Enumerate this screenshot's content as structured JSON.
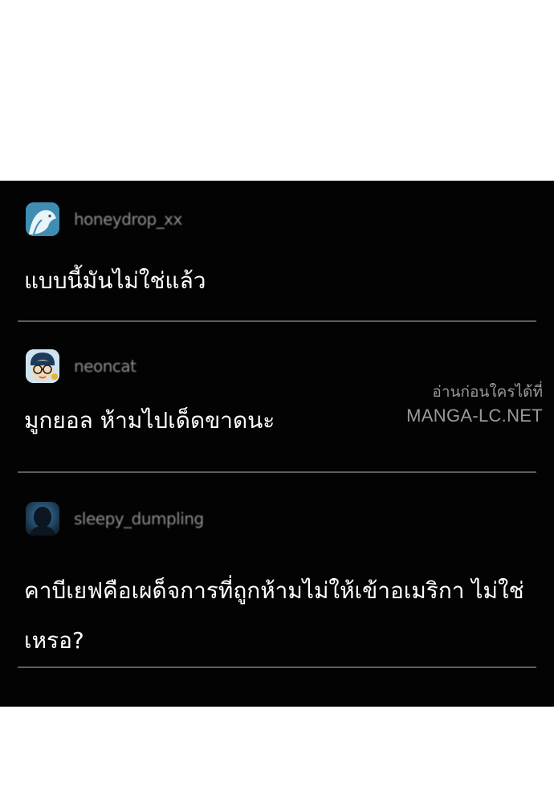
{
  "comments": [
    {
      "username": "honeydrop_xx",
      "avatar_icon": "whale-avatar-icon",
      "text": "แบบนี้มันไม่ใช่แล้ว"
    },
    {
      "username": "neoncat",
      "avatar_icon": "glasses-face-avatar-icon",
      "text": "มูกยอล ห้ามไปเด็ดขาดนะ"
    },
    {
      "username": "sleepy_dumpling",
      "avatar_icon": "silhouette-avatar-icon",
      "text": "คาบีเยฟคือเผด็จการที่ถูกห้ามไม่ให้เข้าอเมริกา ไม่ใช่เหรอ?"
    }
  ],
  "watermark": {
    "line1": "อ่านก่อนใครได้ที่",
    "line2": "MANGA-LC.NET"
  },
  "colors": {
    "panel_background": "#030303",
    "page_background": "#ffffff",
    "text": "#ffffff",
    "username": "#8f8f8f",
    "divider": "#5d5d5d"
  }
}
